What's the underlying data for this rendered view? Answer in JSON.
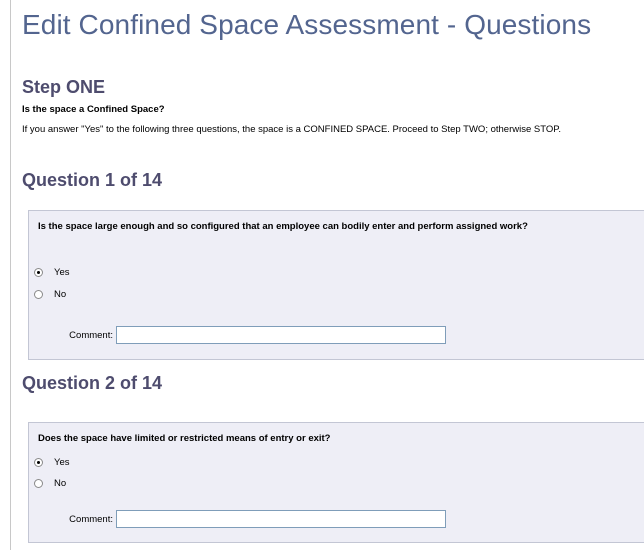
{
  "page": {
    "title": "Edit Confined Space Assessment - Questions"
  },
  "step": {
    "title": "Step ONE",
    "question": "Is the space a Confined Space?",
    "instructions": "If you answer \"Yes\" to the following three questions, the space is a CONFINED SPACE. Proceed to Step TWO; otherwise STOP."
  },
  "questions": [
    {
      "heading": "Question 1 of 14",
      "text": "Is the space large enough and so configured that an employee can bodily enter and perform assigned work?",
      "options": [
        {
          "label": "Yes",
          "checked": true
        },
        {
          "label": "No",
          "checked": false
        }
      ],
      "comment_label": "Comment:",
      "comment_value": ""
    },
    {
      "heading": "Question 2 of 14",
      "text": "Does the space have limited or restricted means of entry or exit?",
      "options": [
        {
          "label": "Yes",
          "checked": true
        },
        {
          "label": "No",
          "checked": false
        }
      ],
      "comment_label": "Comment:",
      "comment_value": ""
    }
  ],
  "colors": {
    "title": "#53658f",
    "heading": "#4e4c6e",
    "panel_background": "#eeeef6",
    "panel_border": "#c3c6d4"
  }
}
